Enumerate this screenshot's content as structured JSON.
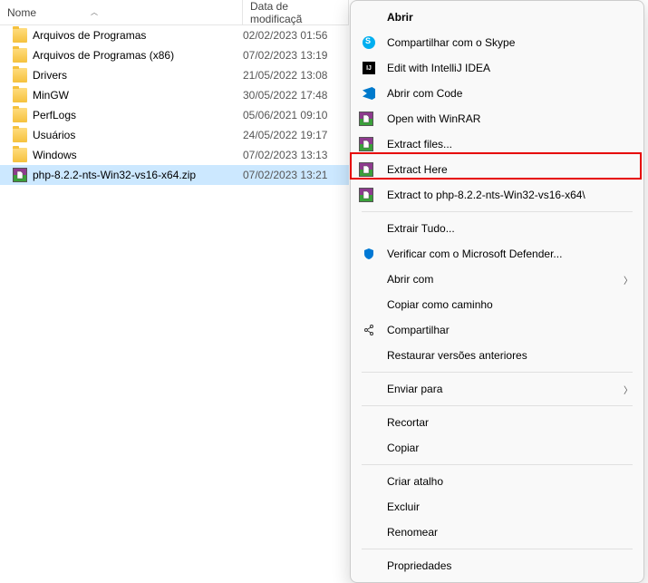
{
  "columns": {
    "name": "Nome",
    "date": "Data de modificaçã"
  },
  "files": [
    {
      "icon": "folder",
      "name": "Arquivos de Programas",
      "date": "02/02/2023 01:56",
      "selected": false
    },
    {
      "icon": "folder",
      "name": "Arquivos de Programas (x86)",
      "date": "07/02/2023 13:19",
      "selected": false
    },
    {
      "icon": "folder",
      "name": "Drivers",
      "date": "21/05/2022 13:08",
      "selected": false
    },
    {
      "icon": "folder",
      "name": "MinGW",
      "date": "30/05/2022 17:48",
      "selected": false
    },
    {
      "icon": "folder",
      "name": "PerfLogs",
      "date": "05/06/2021 09:10",
      "selected": false
    },
    {
      "icon": "folder",
      "name": "Usuários",
      "date": "24/05/2022 19:17",
      "selected": false
    },
    {
      "icon": "folder",
      "name": "Windows",
      "date": "07/02/2023 13:13",
      "selected": false
    },
    {
      "icon": "winrar",
      "name": "php-8.2.2-nts-Win32-vs16-x64.zip",
      "date": "07/02/2023 13:21",
      "selected": true
    }
  ],
  "menu": [
    {
      "type": "item",
      "icon": "",
      "label": "Abrir",
      "bold": true
    },
    {
      "type": "item",
      "icon": "skype",
      "label": "Compartilhar com o Skype"
    },
    {
      "type": "item",
      "icon": "intellij",
      "label": "Edit with IntelliJ IDEA"
    },
    {
      "type": "item",
      "icon": "vscode",
      "label": "Abrir com Code"
    },
    {
      "type": "item",
      "icon": "winrar",
      "label": "Open with WinRAR"
    },
    {
      "type": "item",
      "icon": "winrar",
      "label": "Extract files..."
    },
    {
      "type": "item",
      "icon": "winrar",
      "label": "Extract Here"
    },
    {
      "type": "item",
      "icon": "winrar",
      "label": "Extract to php-8.2.2-nts-Win32-vs16-x64\\",
      "highlight": true
    },
    {
      "type": "sep"
    },
    {
      "type": "item",
      "icon": "",
      "label": "Extrair Tudo..."
    },
    {
      "type": "item",
      "icon": "defender",
      "label": "Verificar com o Microsoft Defender..."
    },
    {
      "type": "item",
      "icon": "",
      "label": "Abrir com",
      "submenu": true
    },
    {
      "type": "item",
      "icon": "",
      "label": "Copiar como caminho"
    },
    {
      "type": "item",
      "icon": "share",
      "label": "Compartilhar"
    },
    {
      "type": "item",
      "icon": "",
      "label": "Restaurar versões anteriores"
    },
    {
      "type": "sep"
    },
    {
      "type": "item",
      "icon": "",
      "label": "Enviar para",
      "submenu": true
    },
    {
      "type": "sep"
    },
    {
      "type": "item",
      "icon": "",
      "label": "Recortar"
    },
    {
      "type": "item",
      "icon": "",
      "label": "Copiar"
    },
    {
      "type": "sep"
    },
    {
      "type": "item",
      "icon": "",
      "label": "Criar atalho"
    },
    {
      "type": "item",
      "icon": "",
      "label": "Excluir"
    },
    {
      "type": "item",
      "icon": "",
      "label": "Renomear"
    },
    {
      "type": "sep"
    },
    {
      "type": "item",
      "icon": "",
      "label": "Propriedades"
    }
  ]
}
